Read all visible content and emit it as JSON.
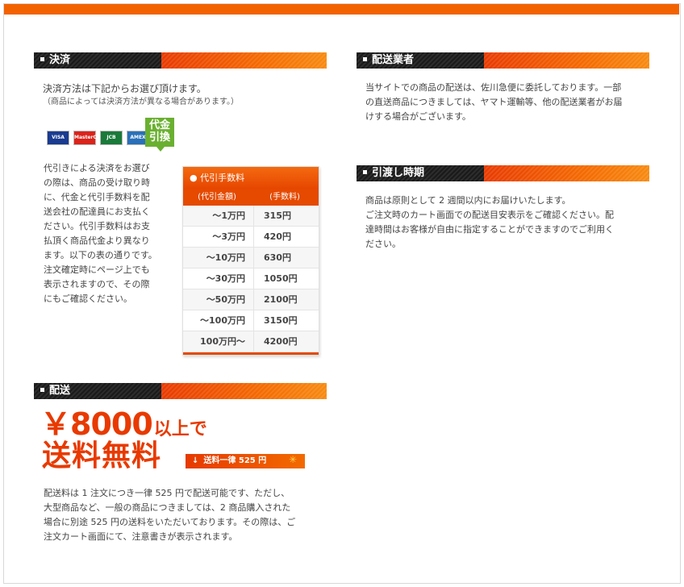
{
  "sections": {
    "payment": {
      "title": "決済"
    },
    "carrier": {
      "title": "配送業者"
    },
    "delivery_time": {
      "title": "引渡し時期"
    },
    "shipping": {
      "title": "配送"
    }
  },
  "payment": {
    "intro": "決済方法は下記からお選び頂けます。",
    "note": "（商品によっては決済方法が異なる場合があります。）",
    "cards": [
      {
        "name": "VISA",
        "color": "#1a3b8f"
      },
      {
        "name": "MasterCard",
        "color": "#d9241b"
      },
      {
        "name": "JCB",
        "color": "#1a7a3a"
      },
      {
        "name": "AMEX",
        "color": "#2a70b8"
      }
    ],
    "cod_badge_1": "代金",
    "cod_badge_2": "引換",
    "cod_lines": [
      "代引きによる決済をお選び",
      "の際は、商品の受け取り時",
      "に、代金と代引手数料を配",
      "送会社の配達員にお支払く",
      "ださい。代引手数料はお支",
      "払頂く商品代金より異なり",
      "ます。以下の表の通りです。",
      "注文確定時にページ上でも",
      "表示されますので、その際",
      "にもご確認ください。"
    ]
  },
  "fee_table": {
    "title": "● 代引手数料",
    "col1": "(代引金額)",
    "col2": "(手数料)",
    "rows": [
      {
        "amount": "〜1万円",
        "fee": "315円"
      },
      {
        "amount": "〜3万円",
        "fee": "420円"
      },
      {
        "amount": "〜10万円",
        "fee": "630円"
      },
      {
        "amount": "〜30万円",
        "fee": "1050円"
      },
      {
        "amount": "〜50万円",
        "fee": "2100円"
      },
      {
        "amount": "〜100万円",
        "fee": "3150円"
      },
      {
        "amount": "100万円〜",
        "fee": "4200円"
      }
    ]
  },
  "carrier": {
    "lines": [
      "当サイトでの商品の配送は、佐川急便に委託しております。一部",
      "の直送商品につきましては、ヤマト運輸等、他の配送業者がお届",
      "けする場合がございます。"
    ]
  },
  "delivery_time": {
    "lines": [
      "商品は原則として 2 週間以内にお届けいたします。",
      "ご注文時のカート画面での配送目安表示をご確認ください。配",
      "達時間はお客様が自由に指定することができますのでご利用く",
      "ださい。"
    ]
  },
  "shipping": {
    "price": "￥8000",
    "price_suffix": "以上で",
    "free_label": "送料無料",
    "flat_label": "送料一律 525 円",
    "lines": [
      "配送料は 1 注文につき一律 525 円で配送可能です、ただし、",
      "大型商品など、一般の商品につきましては、2 商品購入された",
      "場合に別途 525 円の送料をいただいております。その際は、ご",
      "注文カート画面にて、注意書きが表示されます。"
    ]
  }
}
